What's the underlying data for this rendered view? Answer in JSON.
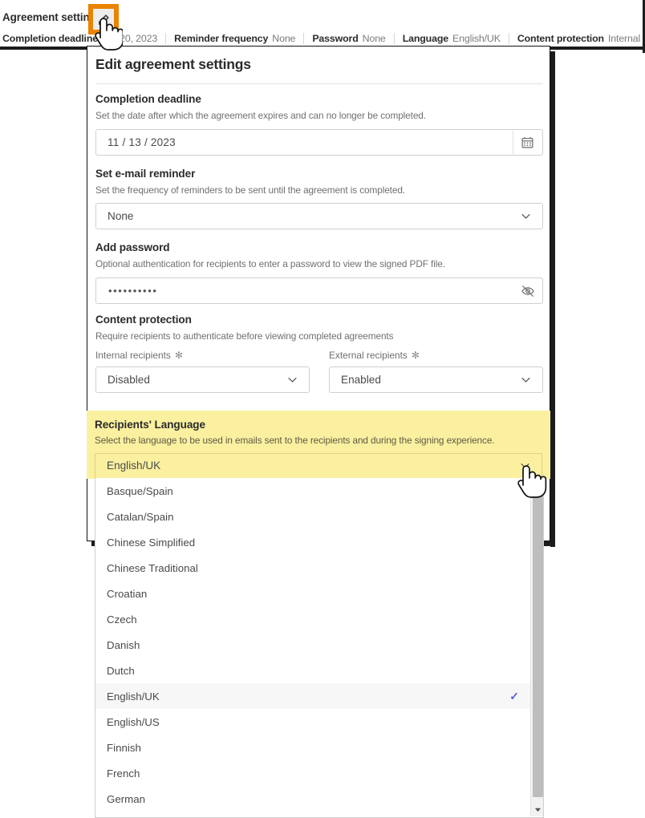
{
  "topbar": {
    "title": "Agreement settings",
    "edit_button_label": "Edit",
    "meta": [
      {
        "key": "Completion deadline",
        "value": "Oct 20, 2023"
      },
      {
        "key": "Reminder frequency",
        "value": "None"
      },
      {
        "key": "Password",
        "value": "None"
      },
      {
        "key": "Language",
        "value": "English/UK"
      },
      {
        "key": "Content protection",
        "value": "Internal disabled & External enabled"
      }
    ]
  },
  "dialog": {
    "title": "Edit agreement settings",
    "sections": {
      "deadline": {
        "title": "Completion deadline",
        "description": "Set the date after which the agreement expires and can no longer be completed.",
        "value": "11 /  13 /  2023",
        "icon": "calendar-icon"
      },
      "reminder": {
        "title": "Set e-mail reminder",
        "description": "Set the frequency of reminders to be sent until the agreement is completed.",
        "value": "None"
      },
      "password": {
        "title": "Add password",
        "description": "Optional authentication for recipients to enter a password to view the signed PDF file.",
        "value": "••••••••••",
        "icon": "eye-off-icon"
      },
      "content_protection": {
        "title": "Content protection",
        "description": "Require recipients to authenticate before viewing completed agreements",
        "internal_label": "Internal recipients",
        "internal_required_mark": "✻",
        "internal_value": "Disabled",
        "external_label": "External recipients",
        "external_required_mark": "✻",
        "external_value": "Enabled"
      },
      "language": {
        "title": "Recipients' Language",
        "description": "Select the language to be used in emails sent to the recipients and during the signing experience.",
        "value": "English/UK",
        "highlight_color": "#FAF0A0"
      }
    }
  },
  "dropdown": {
    "selected": "English/UK",
    "check_mark": "✓",
    "accent_color": "#5B5FD9",
    "options": [
      {
        "label": "Basque/Spain",
        "selected": false
      },
      {
        "label": "Catalan/Spain",
        "selected": false
      },
      {
        "label": "Chinese Simplified",
        "selected": false
      },
      {
        "label": "Chinese Traditional",
        "selected": false
      },
      {
        "label": "Croatian",
        "selected": false
      },
      {
        "label": "Czech",
        "selected": false
      },
      {
        "label": "Danish",
        "selected": false
      },
      {
        "label": "Dutch",
        "selected": false
      },
      {
        "label": "English/UK",
        "selected": true
      },
      {
        "label": "English/US",
        "selected": false
      },
      {
        "label": "Finnish",
        "selected": false
      },
      {
        "label": "French",
        "selected": false
      },
      {
        "label": "German",
        "selected": false
      }
    ],
    "scroll_down_arrow": "▼"
  }
}
